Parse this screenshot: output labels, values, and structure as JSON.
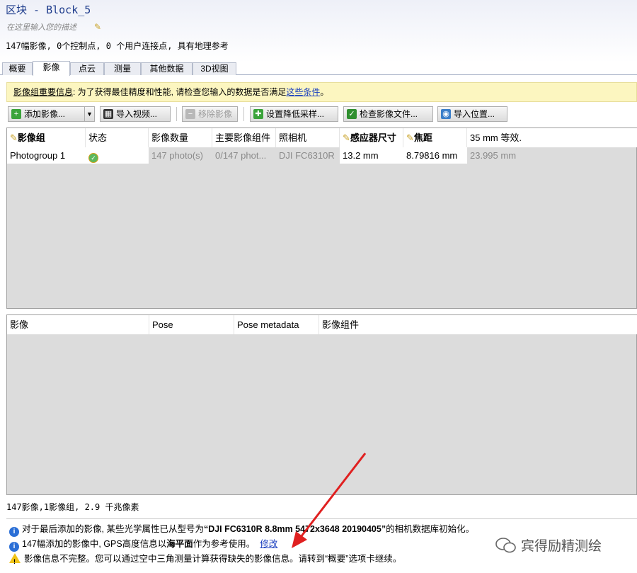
{
  "header": {
    "title": "区块 - Block_5",
    "description_placeholder": "在这里输入您的描述",
    "summary": "147幅影像, 0个控制点, 0 个用户连接点, 具有地理参考"
  },
  "tabs": [
    {
      "label": "概要"
    },
    {
      "label": "影像"
    },
    {
      "label": "点云"
    },
    {
      "label": "测量"
    },
    {
      "label": "其他数据"
    },
    {
      "label": "3D视图"
    }
  ],
  "infobar": {
    "title": "影像组重要信息",
    "text": ": 为了获得最佳精度和性能, 请检查您输入的数据是否满足",
    "link": "这些条件",
    "end": "。"
  },
  "toolbar": {
    "add_images": "添加影像...",
    "import_video": "导入视频...",
    "remove_images": "移除影像",
    "downsample": "设置降低采样...",
    "check_files": "检查影像文件...",
    "import_positions": "导入位置..."
  },
  "photogroups": {
    "columns": [
      "影像组",
      "状态",
      "影像数量",
      "主要影像组件",
      "照相机",
      "感应器尺寸",
      "焦距",
      "35 mm 等效."
    ],
    "row": {
      "name": "Photogroup 1",
      "status_icon": "check-ok-icon",
      "count": "147 photo(s)",
      "component": "0/147 phot...",
      "camera": "DJI FC6310R",
      "sensor": "13.2 mm",
      "focal": "8.79816 mm",
      "equiv": "23.995 mm"
    }
  },
  "images_table": {
    "columns": [
      "影像",
      "Pose",
      "Pose metadata",
      "影像组件"
    ]
  },
  "footer": {
    "count": "147影像,1影像组, 2.9 千兆像素"
  },
  "messages": {
    "m1_pre": "对于最后添加的影像, 某些光学属性已从型号为",
    "m1_bold": "“DJI FC6310R 8.8mm 5472x3648 20190405”",
    "m1_post": "的相机数据库初始化。",
    "m2_pre": "147幅添加的影像中, GPS高度信息以",
    "m2_bold": "海平面",
    "m2_post": "作为参考使用。",
    "m2_link": "修改",
    "m3": "影像信息不完整。您可以通过空中三角测量计算获得缺失的影像信息。请转到“概要”选项卡继续。"
  },
  "watermark": "宾得励精测绘",
  "colors": {
    "title": "#1e3c8c",
    "infobar_bg": "#fcf6c0",
    "link": "#1a3fbf",
    "arrow": "#e02020"
  }
}
